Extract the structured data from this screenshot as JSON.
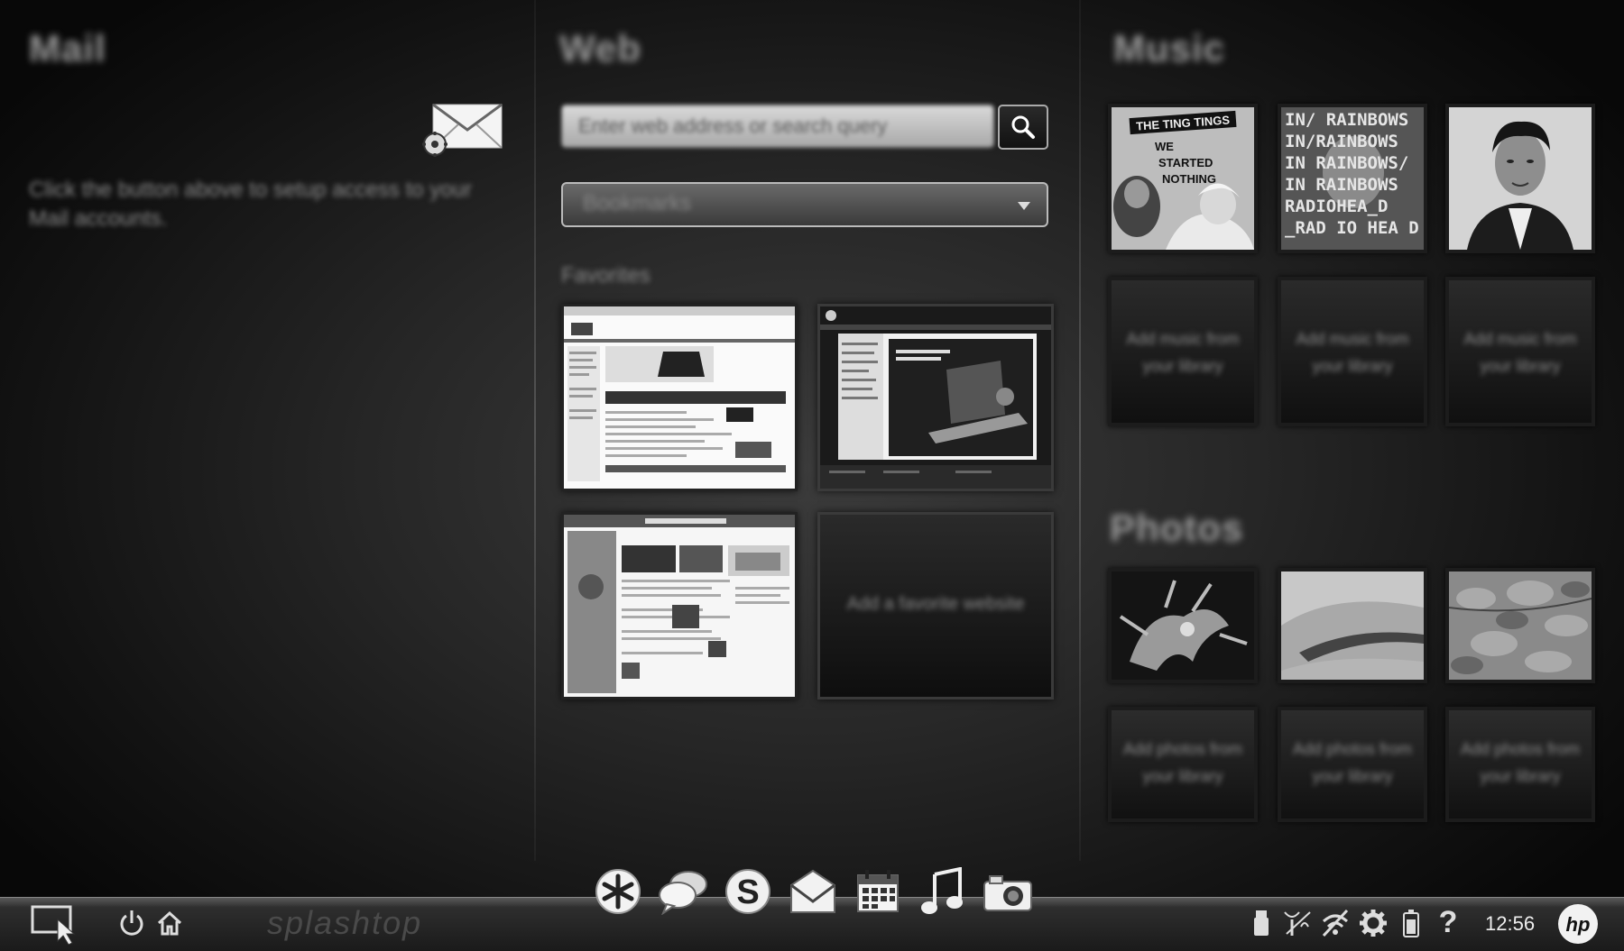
{
  "mail": {
    "title": "Mail",
    "hint": "Click the button above to setup access to your Mail accounts."
  },
  "web": {
    "title": "Web",
    "search_placeholder": "Enter web address or search query",
    "bookmarks_label": "Bookmarks",
    "favorites_label": "Favorites",
    "empty_favorite_label": "Add a favorite website"
  },
  "music": {
    "title": "Music",
    "albums": [
      {
        "icon": "album-art-ting-tings-icon",
        "text": "THE TING TINGS  WE STARTED NOTHING"
      },
      {
        "icon": "album-art-in-rainbows-icon",
        "lines": [
          "IN/ RAINBOWS",
          "IN/RAINBOWS",
          "IN RAINBOWS/",
          "IN RAINBOWS",
          "RADIOHEA_D",
          "_RAD IO HEA D"
        ]
      },
      {
        "icon": "album-art-portrait-icon"
      }
    ],
    "empty_label": "Add music from your library"
  },
  "photos": {
    "title": "Photos",
    "empty_label": "Add photos from your library"
  },
  "taskbar": {
    "brand": "splashtop",
    "clock": "12:56",
    "help": "?",
    "hp_logo": "hp"
  },
  "colors": {
    "background": "#262626",
    "taskbar": "#1a1a1a",
    "text_light": "#eeeeee"
  }
}
